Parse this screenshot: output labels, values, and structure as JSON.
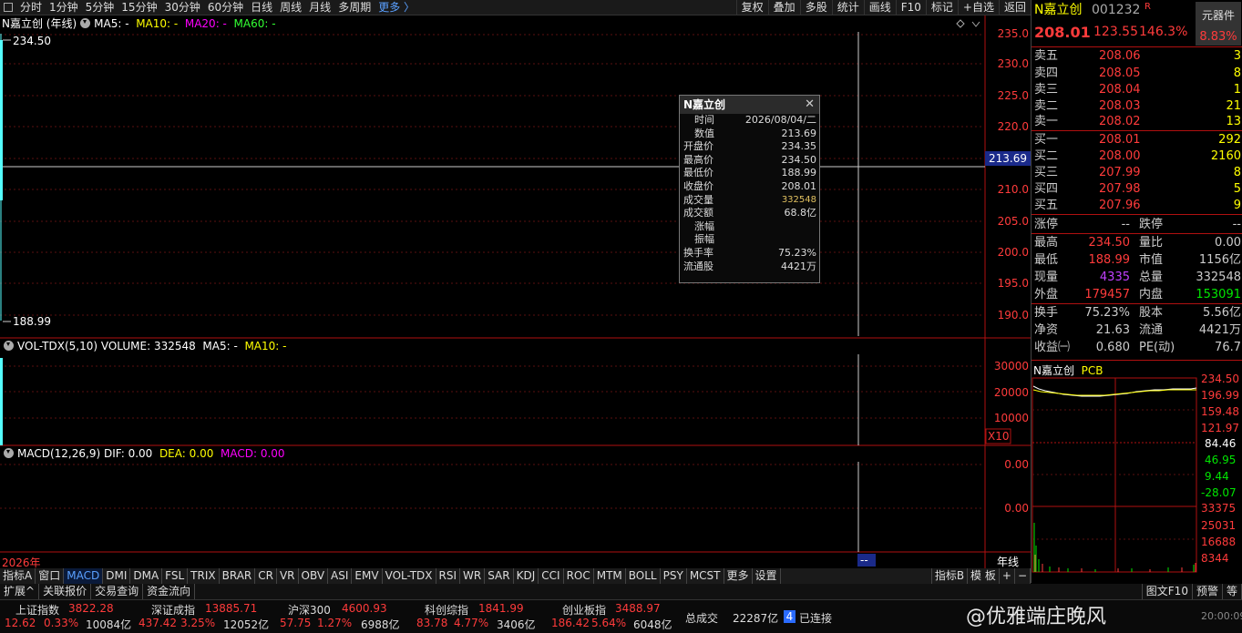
{
  "toolbar": {
    "items": [
      "分时",
      "1分钟",
      "5分钟",
      "15分钟",
      "30分钟",
      "60分钟",
      "日线",
      "周线",
      "月线",
      "多周期"
    ],
    "more": "更多 〉",
    "right": [
      "复权",
      "叠加",
      "多股",
      "统计",
      "画线",
      "F10",
      "标记",
      "+自选",
      "返回"
    ]
  },
  "main": {
    "title": "N嘉立创 (年线)",
    "ma5": "MA5: -",
    "ma10": "MA10: -",
    "ma20": "MA20: -",
    "ma60": "MA60: -",
    "high_mark": "234.50",
    "low_mark": "188.99",
    "yticks": [
      "235.0",
      "230.0",
      "225.0",
      "220.0",
      "215.0",
      "210.0",
      "205.0",
      "200.0",
      "195.0",
      "190.0"
    ],
    "cursor_value": "213.69"
  },
  "tooltip": {
    "title": "N嘉立创",
    "rows": [
      [
        "时间",
        "2026/08/04/二"
      ],
      [
        "数值",
        "213.69"
      ],
      [
        "开盘价",
        "234.35"
      ],
      [
        "最高价",
        "234.50"
      ],
      [
        "最低价",
        "188.99"
      ],
      [
        "收盘价",
        "208.01"
      ],
      [
        "成交量",
        "332548"
      ],
      [
        "成交额",
        "68.8亿"
      ],
      [
        "涨幅",
        ""
      ],
      [
        "振幅",
        ""
      ],
      [
        "换手率",
        "75.23%"
      ],
      [
        "流通股",
        "4421万"
      ]
    ]
  },
  "vol": {
    "name": "VOL-TDX(5,10)",
    "volume": "VOLUME: 332548",
    "ma5": "MA5: -",
    "ma10": "MA10: -",
    "yticks": [
      "30000",
      "20000",
      "10000"
    ],
    "unit": "X10"
  },
  "macd": {
    "name": "MACD(12,26,9)",
    "dif": "DIF: 0.00",
    "dea": "DEA: 0.00",
    "macd": "MACD: 0.00",
    "yticks": [
      "0.00",
      "0.00"
    ]
  },
  "xaxis": {
    "year": "2026年",
    "cursor": "--",
    "period": "年线"
  },
  "quote": {
    "name": "N嘉立创",
    "code": "001232",
    "badge": "R",
    "sector": "元器件",
    "price": "208.01",
    "change": "123.55",
    "pct": "146.3%",
    "side_pct": "8.83%",
    "asks": [
      [
        "卖五",
        "208.06",
        "3"
      ],
      [
        "卖四",
        "208.05",
        "8"
      ],
      [
        "卖三",
        "208.04",
        "1"
      ],
      [
        "卖二",
        "208.03",
        "21"
      ],
      [
        "卖一",
        "208.02",
        "13"
      ]
    ],
    "bids": [
      [
        "买一",
        "208.01",
        "292"
      ],
      [
        "买二",
        "208.00",
        "2160"
      ],
      [
        "买三",
        "207.99",
        "8"
      ],
      [
        "买四",
        "207.98",
        "5"
      ],
      [
        "买五",
        "207.96",
        "9"
      ]
    ],
    "stats": [
      [
        "涨停",
        "--",
        "跌停",
        "--"
      ],
      [
        "最高",
        "234.50",
        "量比",
        "0.00"
      ],
      [
        "最低",
        "188.99",
        "市值",
        "1156亿"
      ],
      [
        "现量",
        "4335",
        "总量",
        "332548"
      ],
      [
        "外盘",
        "179457",
        "内盘",
        "153091"
      ],
      [
        "换手",
        "75.23%",
        "股本",
        "5.56亿"
      ],
      [
        "净资",
        "21.63",
        "流通",
        "4421万"
      ],
      [
        "收益㈠",
        "0.680",
        "PE(动)",
        "76.7"
      ]
    ]
  },
  "mini": {
    "name": "N嘉立创",
    "tag": "PCB",
    "ticks": [
      "234.50",
      "196.99",
      "159.48",
      "121.97",
      "84.46",
      "46.95",
      "9.44",
      "-28.07",
      "33375",
      "25031",
      "16688",
      "8344"
    ]
  },
  "indicators": [
    "指标A",
    "窗口",
    "MACD",
    "DMI",
    "DMA",
    "FSL",
    "TRIX",
    "BRAR",
    "CR",
    "VR",
    "OBV",
    "ASI",
    "EMV",
    "VOL-TDX",
    "RSI",
    "WR",
    "SAR",
    "KDJ",
    "CCI",
    "ROC",
    "MTM",
    "BOLL",
    "PSY",
    "MCST",
    "更多",
    "设置"
  ],
  "indicators_right": [
    "指标B",
    "模 板",
    "+",
    "−"
  ],
  "tabs2": [
    "扩展^",
    "关联报价",
    "交易查询",
    "资金流向"
  ],
  "tabs2_right": [
    "图文F10",
    "预警",
    "等"
  ],
  "status": {
    "indices": [
      [
        "上证指数",
        "3822.28",
        "12.62",
        "0.33%",
        "10084亿"
      ],
      [
        "深证成指",
        "13885.71",
        "437.42",
        "3.25%",
        "12052亿"
      ],
      [
        "沪深300",
        "4600.93",
        "57.75",
        "1.27%",
        "6988亿"
      ],
      [
        "科创综指",
        "1841.99",
        "83.78",
        "4.77%",
        "3406亿"
      ],
      [
        "创业板指",
        "3488.97",
        "186.42",
        "5.64%",
        "6048亿"
      ]
    ],
    "total_label": "总成交",
    "total": "22287亿",
    "conn_num": "4",
    "conn": "已连接",
    "watermark": "@优雅端庄晚风",
    "clock": "20:00:09"
  }
}
